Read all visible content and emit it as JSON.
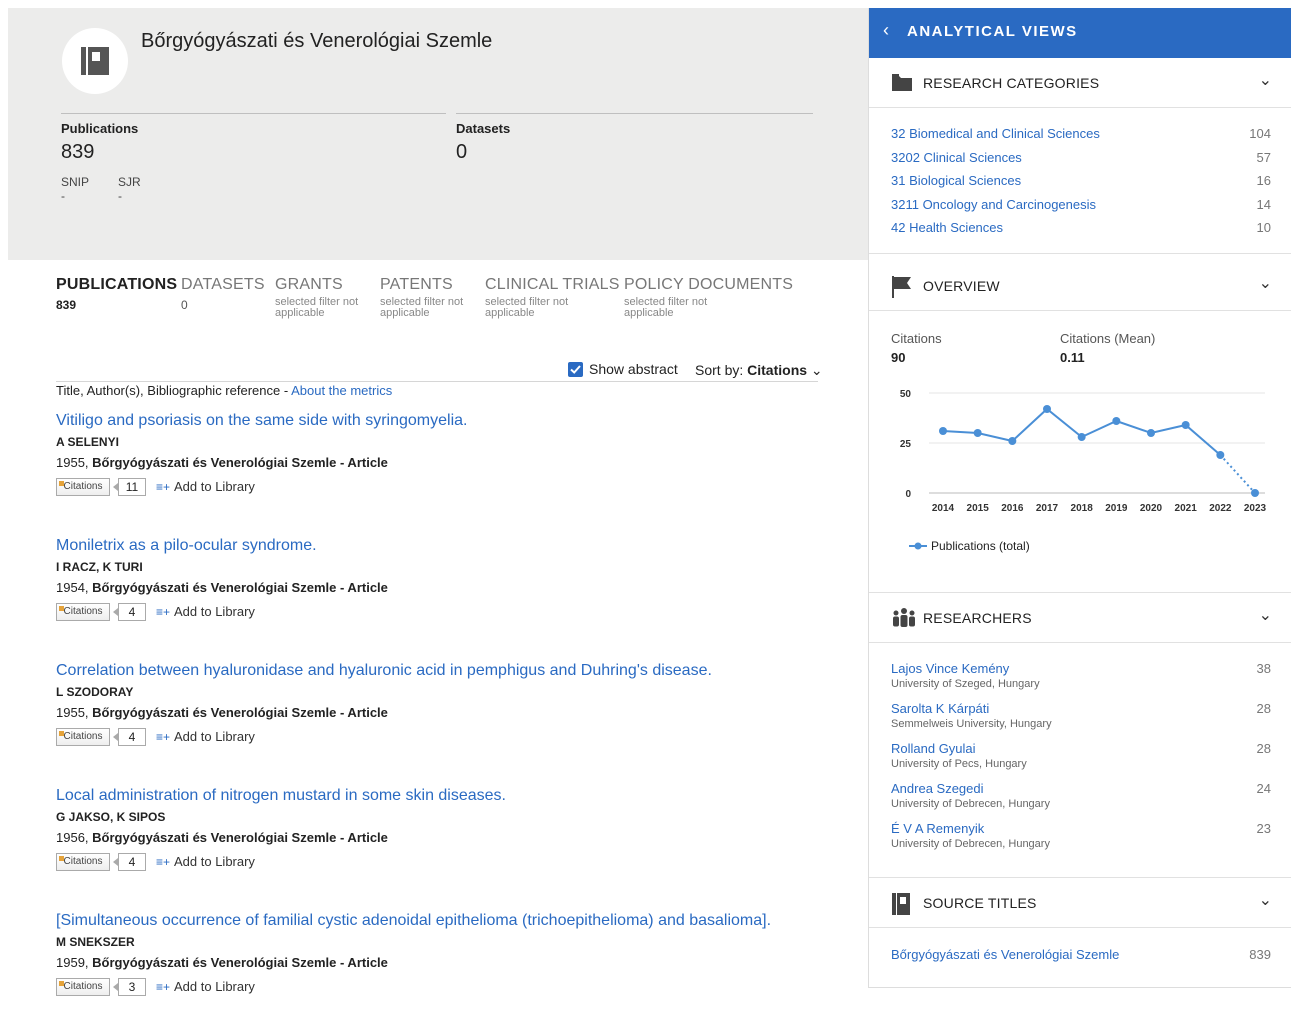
{
  "journal": {
    "title": "Bőrgyógyászati és Venerológiai Szemle",
    "publications_label": "Publications",
    "publications_value": "839",
    "datasets_label": "Datasets",
    "datasets_value": "0",
    "snip_label": "SNIP",
    "sjr_label": "SJR",
    "snip_value": "-",
    "sjr_value": "-"
  },
  "tabs": [
    {
      "title": "PUBLICATIONS",
      "count": "839",
      "note": ""
    },
    {
      "title": "DATASETS",
      "count": "0",
      "note": ""
    },
    {
      "title": "GRANTS",
      "count": "",
      "note": "selected filter not applicable"
    },
    {
      "title": "PATENTS",
      "count": "",
      "note": "selected filter not applicable"
    },
    {
      "title": "CLINICAL TRIALS",
      "count": "",
      "note": "selected filter not applicable"
    },
    {
      "title": "POLICY DOCUMENTS",
      "count": "",
      "note": "selected filter not applicable"
    }
  ],
  "controls": {
    "show_abstract": "Show abstract",
    "sort_label": "Sort by:",
    "sort_value": "Citations"
  },
  "list_header": {
    "text": "Title, Author(s), Bibliographic reference - ",
    "link": "About the metrics"
  },
  "publications": [
    {
      "title": "Vitiligo and psoriasis on the same side with syringomyelia.",
      "authors": "A SELENYI",
      "year": "1955, ",
      "journal": "Bőrgyógyászati és Venerológiai Szemle",
      "type": " - Article",
      "citations_label": "Citations",
      "citations": "11",
      "add": "Add to Library"
    },
    {
      "title": "Moniletrix as a pilo-ocular syndrome.",
      "authors": "I RACZ, K TURI",
      "year": "1954, ",
      "journal": "Bőrgyógyászati és Venerológiai Szemle",
      "type": " - Article",
      "citations_label": "Citations",
      "citations": "4",
      "add": "Add to Library"
    },
    {
      "title": "Correlation between hyaluronidase and hyaluronic acid in pemphigus and Duhring's disease.",
      "authors": "L SZODORAY",
      "year": "1955, ",
      "journal": "Bőrgyógyászati és Venerológiai Szemle",
      "type": " - Article",
      "citations_label": "Citations",
      "citations": "4",
      "add": "Add to Library"
    },
    {
      "title": "Local administration of nitrogen mustard in some skin diseases.",
      "authors": "G JAKSO, K SIPOS",
      "year": "1956, ",
      "journal": "Bőrgyógyászati és Venerológiai Szemle",
      "type": " - Article",
      "citations_label": "Citations",
      "citations": "4",
      "add": "Add to Library"
    },
    {
      "title": "[Simultaneous occurrence of familial cystic adenoidal epithelioma (trichoepithelioma) and basalioma].",
      "authors": "M SNEKSZER",
      "year": "1959, ",
      "journal": "Bőrgyógyászati és Venerológiai Szemle",
      "type": " - Article",
      "citations_label": "Citations",
      "citations": "3",
      "add": "Add to Library"
    }
  ],
  "analytical": {
    "header": "ANALYTICAL VIEWS",
    "research_categories": {
      "label": "RESEARCH CATEGORIES",
      "items": [
        {
          "name": "32 Biomedical and Clinical Sciences",
          "value": "104"
        },
        {
          "name": "3202 Clinical Sciences",
          "value": "57"
        },
        {
          "name": "31 Biological Sciences",
          "value": "16"
        },
        {
          "name": "3211 Oncology and Carcinogenesis",
          "value": "14"
        },
        {
          "name": "42 Health Sciences",
          "value": "10"
        }
      ]
    },
    "overview": {
      "label": "OVERVIEW",
      "citations_label": "Citations",
      "citations_value": "90",
      "mean_label": "Citations (Mean)",
      "mean_value": "0.11"
    },
    "researchers": {
      "label": "RESEARCHERS",
      "items": [
        {
          "name": "Lajos Vince Kemény",
          "affiliation": "University of Szeged, Hungary",
          "value": "38"
        },
        {
          "name": "Sarolta K Kárpáti",
          "affiliation": "Semmelweis University, Hungary",
          "value": "28"
        },
        {
          "name": "Rolland Gyulai",
          "affiliation": "University of Pecs, Hungary",
          "value": "28"
        },
        {
          "name": "Andrea Szegedi",
          "affiliation": "University of Debrecen, Hungary",
          "value": "24"
        },
        {
          "name": "É V A Remenyik",
          "affiliation": "University of Debrecen, Hungary",
          "value": "23"
        }
      ]
    },
    "source_titles": {
      "label": "SOURCE TITLES",
      "items": [
        {
          "name": "Bőrgyógyászati és Venerológiai Szemle",
          "value": "839"
        }
      ]
    }
  },
  "chart_data": {
    "type": "line",
    "title": "",
    "xlabel": "",
    "ylabel": "",
    "x": [
      "2014",
      "2015",
      "2016",
      "2017",
      "2018",
      "2019",
      "2020",
      "2021",
      "2022",
      "2023"
    ],
    "series": [
      {
        "name": "Publications (total)",
        "values": [
          31,
          30,
          26,
          42,
          28,
          36,
          30,
          34,
          19,
          0
        ],
        "color": "#4a8fd6"
      }
    ],
    "yticks": [
      "50",
      "25",
      "0"
    ],
    "ylim": [
      0,
      50
    ],
    "grid": true,
    "legend": "bottom-left",
    "note_last_segment": "dotted"
  }
}
